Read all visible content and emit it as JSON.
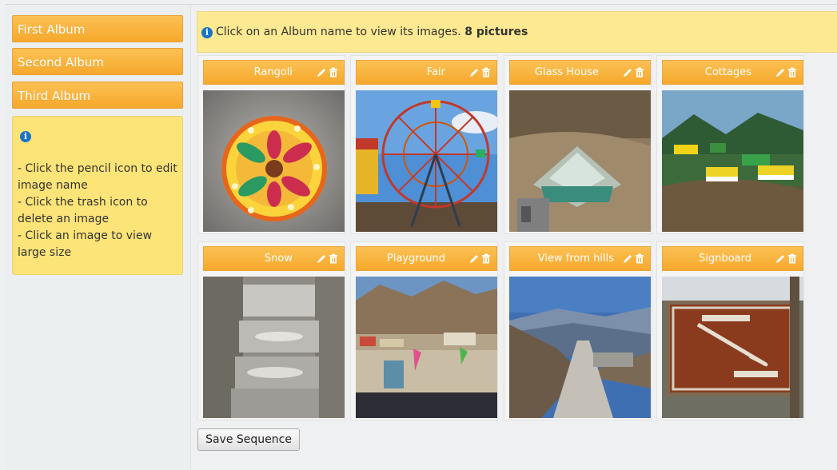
{
  "sidebar": {
    "albums": [
      {
        "label": "First Album"
      },
      {
        "label": "Second Album"
      },
      {
        "label": "Third Album"
      }
    ],
    "help": {
      "icon": "info-icon",
      "lines": [
        "- Click the pencil icon to edit image name",
        "- Click the trash icon to delete an image",
        "- Click an image to view large size"
      ]
    }
  },
  "notice": {
    "icon": "info-icon",
    "text": "Click on an Album name to view its images.",
    "count": "8 pictures"
  },
  "gallery": {
    "items": [
      {
        "title": "Rangoli"
      },
      {
        "title": "Fair"
      },
      {
        "title": "Glass House"
      },
      {
        "title": "Cottages"
      },
      {
        "title": "Snow"
      },
      {
        "title": "Playground"
      },
      {
        "title": "View from hills"
      },
      {
        "title": "Signboard"
      }
    ]
  },
  "actions": {
    "save_label": "Save Sequence"
  },
  "colors": {
    "accent": "#f7ae35",
    "notice_bg": "#fde991",
    "help_bg": "#fde478",
    "info_icon": "#1a72c9"
  }
}
